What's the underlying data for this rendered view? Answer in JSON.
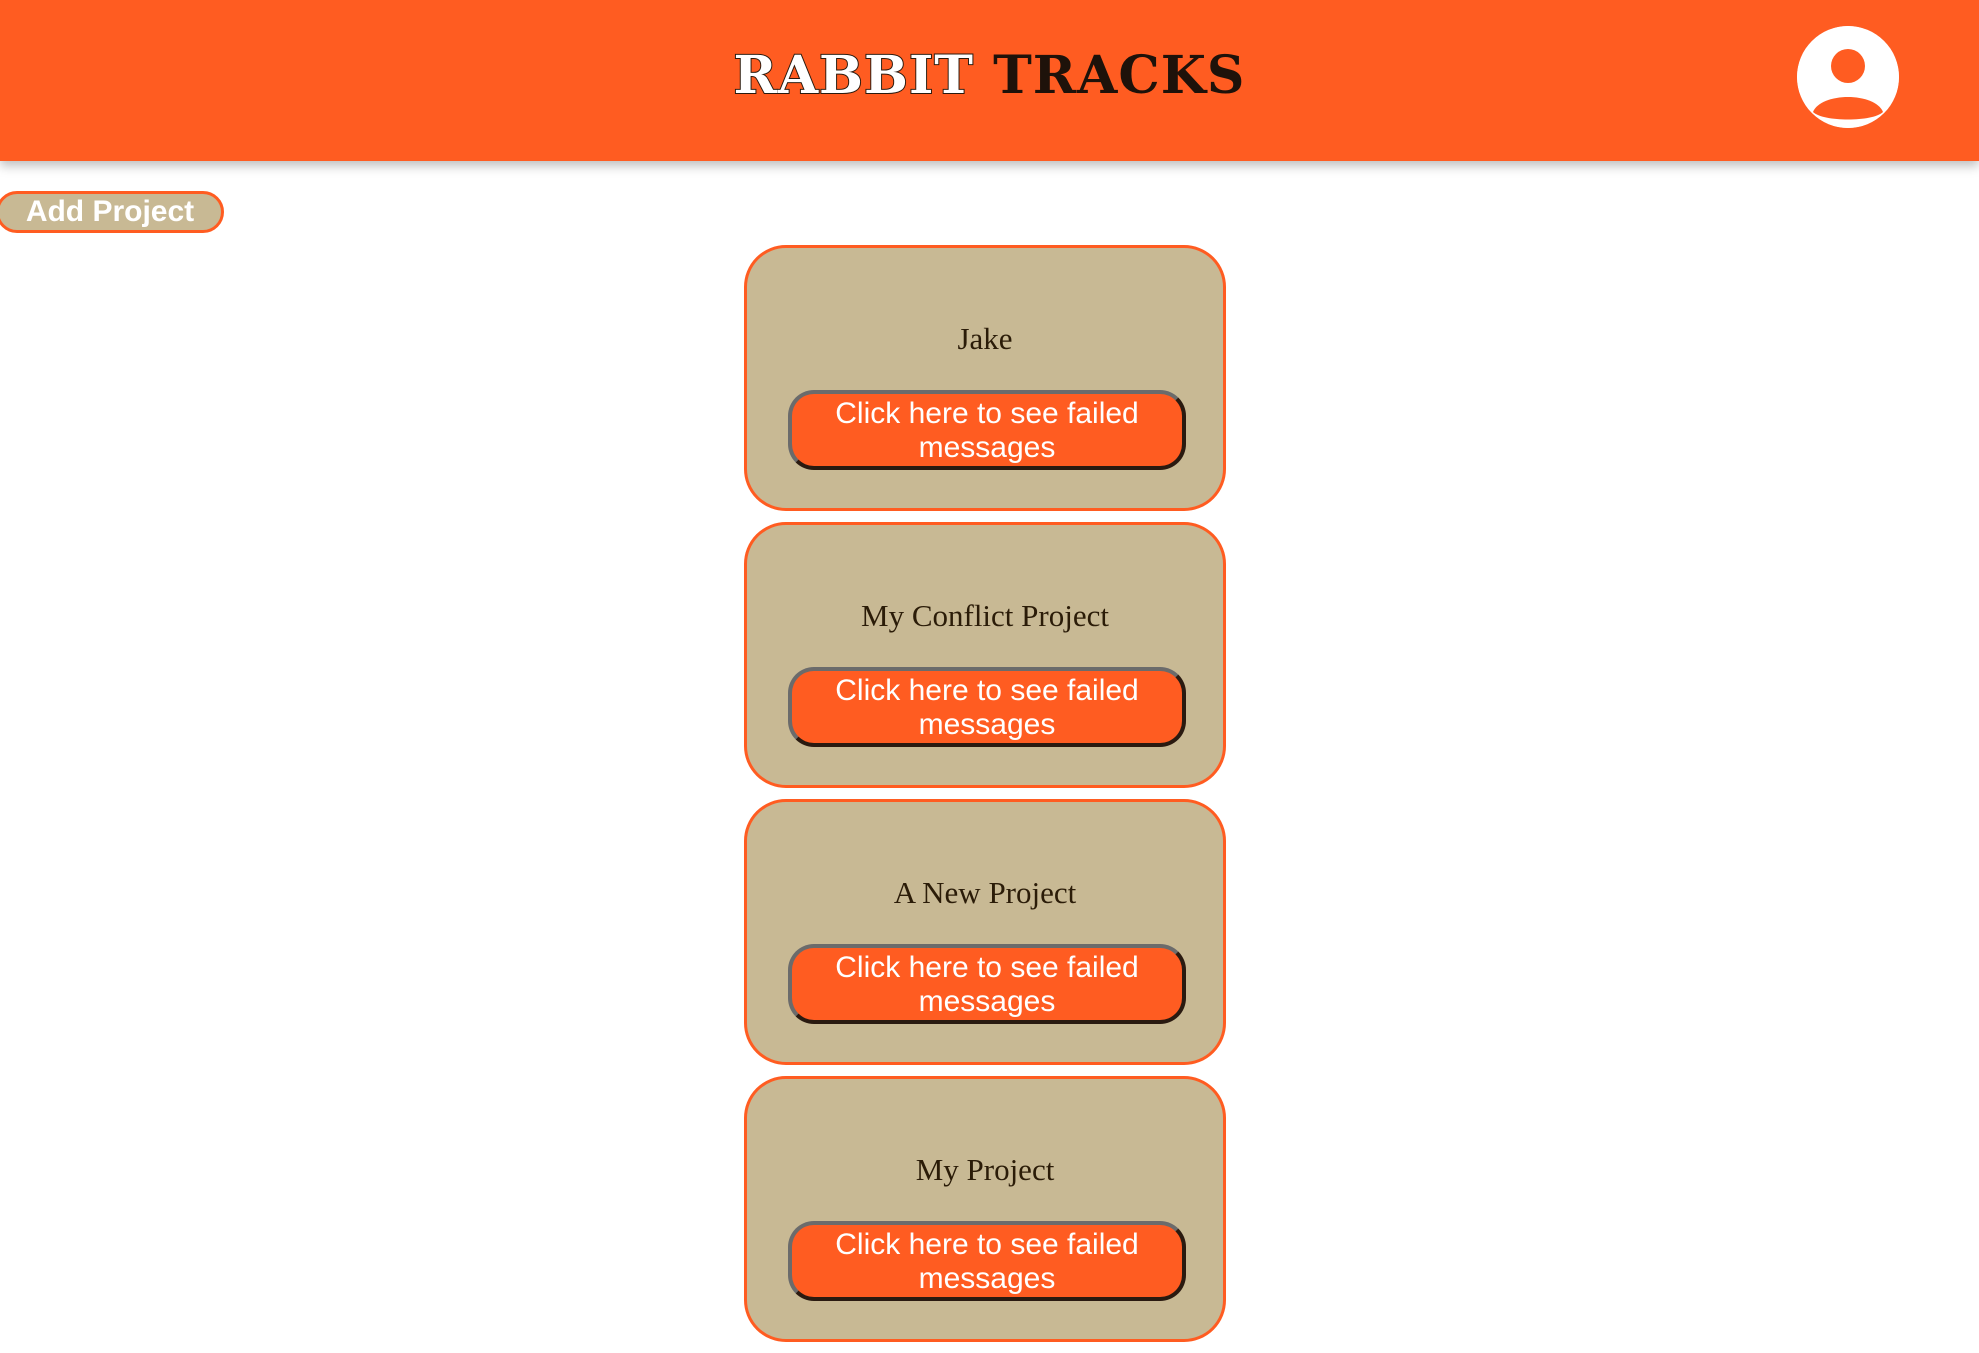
{
  "header": {
    "brand_part1": "RABBIT",
    "brand_part2": "TRACKS",
    "profile_icon": "user-circle-icon"
  },
  "toolbar": {
    "add_project_label": "Add Project"
  },
  "projects": [
    {
      "name": "Jake",
      "button_label": "Click here to see failed messages"
    },
    {
      "name": "My Conflict Project",
      "button_label": "Click here to see failed messages"
    },
    {
      "name": "A New Project",
      "button_label": "Click here to see failed messages"
    },
    {
      "name": "My Project",
      "button_label": "Click here to see failed messages"
    }
  ],
  "colors": {
    "accent": "#ff5c21",
    "card_bg": "#c8b994",
    "text_dark": "#2b1c08",
    "white": "#ffffff"
  }
}
